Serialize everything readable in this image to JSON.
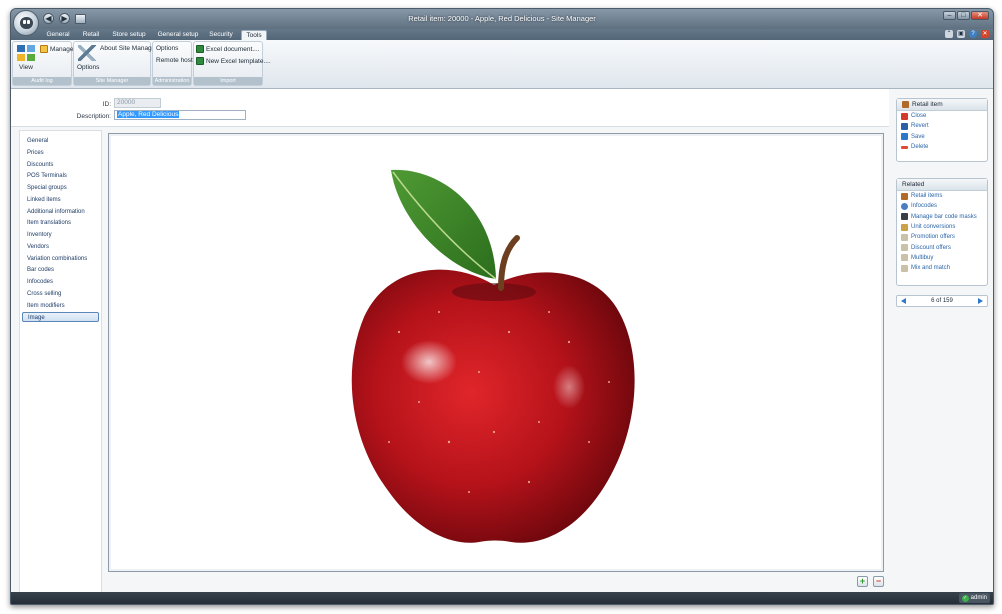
{
  "window": {
    "title": "Retail item: 20000 - Apple, Red Delicious - Site Manager",
    "qat": [
      "◀",
      "▶"
    ]
  },
  "tabs": [
    "General",
    "Retail",
    "Store setup",
    "General setup",
    "Security",
    "Tools"
  ],
  "active_tab": "Tools",
  "ribbon": {
    "groups": [
      {
        "label": "Audit log",
        "buttons": [
          "View",
          "Manage"
        ]
      },
      {
        "label": "Site Manager",
        "buttons": [
          "Options",
          "About Site Manager"
        ]
      },
      {
        "label": "Administration",
        "buttons": [
          "Options",
          "Remote hosts"
        ]
      },
      {
        "label": "Import",
        "buttons": [
          "Excel document....",
          "New Excel template...."
        ]
      }
    ]
  },
  "form": {
    "id_label": "ID:",
    "id_value": "20000",
    "description_label": "Description:",
    "description_value": "Apple, Red Delicious"
  },
  "nav": {
    "items": [
      "General",
      "Prices",
      "Discounts",
      "POS Terminals",
      "Special groups",
      "Linked items",
      "Additional information",
      "Item translations",
      "Inventory",
      "Vendors",
      "Variation combinations",
      "Bar codes",
      "Infocodes",
      "Cross selling",
      "Item modifiers",
      "Image"
    ],
    "active": "Image"
  },
  "retail_item_panel": {
    "title": "Retail item",
    "actions": [
      "Close",
      "Revert",
      "Save",
      "Delete"
    ]
  },
  "related_panel": {
    "title": "Related",
    "links": [
      "Retail items",
      "Infocodes",
      "Manage bar code masks",
      "Unit conversions",
      "Promotion offers",
      "Discount offers",
      "Multibuy",
      "Mix and match"
    ]
  },
  "pager": {
    "text": "6 of 159"
  },
  "image_buttons": {
    "add": "+",
    "remove": "−"
  },
  "status": {
    "user": "admin"
  },
  "colors": {
    "accent": "#2d78c8",
    "title_bar": "#6e7f8f",
    "apple_red": "#c4161c",
    "leaf_green": "#3f8a2a"
  }
}
